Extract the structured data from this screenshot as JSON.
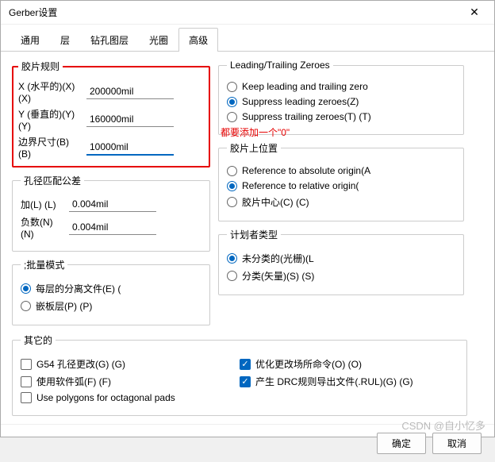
{
  "title": "Gerber设置",
  "tabs": [
    "通用",
    "层",
    "钻孔图层",
    "光圈",
    "高级"
  ],
  "activeTab": 4,
  "annotation": "都要添加一个\"0\"",
  "groups": {
    "filmRules": {
      "legend": "胶片规则",
      "x": {
        "label": "X (水平的)(X) (X)",
        "value": "200000mil"
      },
      "y": {
        "label": "Y (垂直的)(Y) (Y)",
        "value": "160000mil"
      },
      "border": {
        "label": "边界尺寸(B) (B)",
        "value": "10000mil"
      }
    },
    "apertureTol": {
      "legend": "孔径匹配公差",
      "plus": {
        "label": "加(L) (L)",
        "value": "0.004mil"
      },
      "minus": {
        "label": "负数(N) (N)",
        "value": "0.004mil"
      }
    },
    "zeroes": {
      "legend": "Leading/Trailing Zeroes",
      "opts": [
        "Keep leading and trailing zero",
        "Suppress leading zeroes(Z)",
        "Suppress trailing zeroes(T) (T)"
      ],
      "selected": 1
    },
    "filmPos": {
      "legend": "胶片上位置",
      "opts": [
        "Reference to absolute origin(A",
        "Reference to relative origin(",
        "胶片中心(C) (C)"
      ],
      "selected": 1
    },
    "batch": {
      "legend": ";批量模式",
      "opts": [
        "每层的分离文件(E) (",
        "嵌板层(P) (P)"
      ],
      "selected": 0
    },
    "plotter": {
      "legend": "计划者类型",
      "opts": [
        "未分类的(光栅)(L",
        "分类(矢量)(S) (S)"
      ],
      "selected": 0
    },
    "others": {
      "legend": "其它的",
      "left": [
        {
          "label": "G54 孔径更改(G) (G)",
          "checked": false
        },
        {
          "label": "使用软件弧(F) (F)",
          "checked": false
        },
        {
          "label": "Use polygons for octagonal pads",
          "checked": false
        }
      ],
      "right": [
        {
          "label": "优化更改场所命令(O) (O)",
          "checked": true
        },
        {
          "label": "产生 DRC规则导出文件(.RUL)(G) (G)",
          "checked": true
        }
      ]
    }
  },
  "buttons": {
    "ok": "确定",
    "cancel": "取消"
  },
  "watermark": "CSDN @自小忆多"
}
